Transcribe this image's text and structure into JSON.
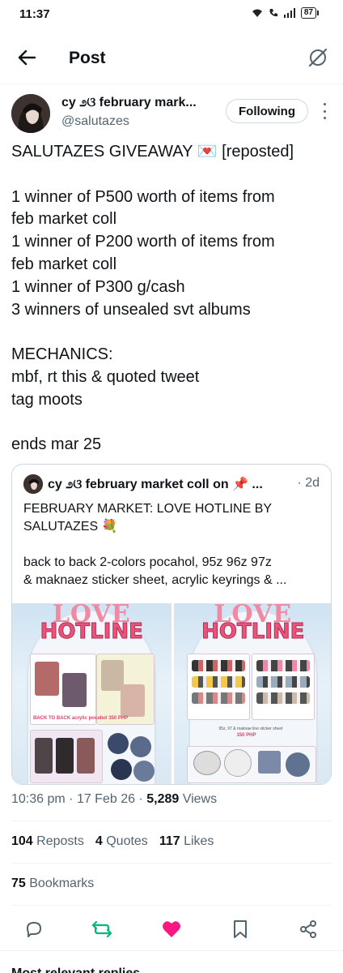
{
  "status_bar": {
    "time": "11:37",
    "battery": "87"
  },
  "header": {
    "title": "Post"
  },
  "author": {
    "name": "cy ೨ଓ february mark...",
    "handle": "@salutazes",
    "follow_label": "Following"
  },
  "post": {
    "lines": [
      "SALUTAZES GIVEAWAY 💌 [reposted]",
      "",
      "1 winner of P500 worth of items from",
      "feb market coll",
      "1 winner of P200 worth of items from",
      "feb market coll",
      "1 winner of P300 g/cash",
      "3 winners of unsealed svt albums",
      "",
      "MECHANICS:",
      "mbf, rt this & quoted tweet",
      "tag moots",
      "",
      "ends mar 25"
    ]
  },
  "quote": {
    "name": "cy ೨ଓ february market coll on 📌 ...",
    "time": "· 2d",
    "text_line1": "FEBRUARY MARKET: LOVE HOTLINE BY",
    "text_line2": "SALUTAZES 💐",
    "text_line3": "back to back 2-colors pocahol, 95z 96z 97z",
    "text_line4": "& maknaez sticker sheet, acrylic keyrings & ...",
    "media": [
      {
        "title_top": "LOVE",
        "title": "HOTLINE",
        "label_1": "back to back",
        "label_2": "BACK TO BACK acrylic pocahol 350 PHP"
      },
      {
        "title_top": "LOVE",
        "title": "HOTLINE",
        "label_1": "95z, 97 & maknae line sticker sheet",
        "label_2": "150 PHP"
      }
    ]
  },
  "meta": {
    "time": "10:36 pm",
    "date": "17 Feb 26",
    "views_count": "5,289",
    "views_label": "Views"
  },
  "stats": {
    "reposts_count": "104",
    "reposts_label": "Reposts",
    "quotes_count": "4",
    "quotes_label": "Quotes",
    "likes_count": "117",
    "likes_label": "Likes",
    "bookmarks_count": "75",
    "bookmarks_label": "Bookmarks"
  },
  "actions": {
    "reply_icon": "reply-icon",
    "repost_icon": "repost-icon",
    "like_icon": "heart-icon",
    "bookmark_icon": "bookmark-icon",
    "share_icon": "share-icon",
    "repost_color": "#00ba7c",
    "like_color": "#f91880"
  },
  "replies_peek": "Most relevant replies ⌄"
}
